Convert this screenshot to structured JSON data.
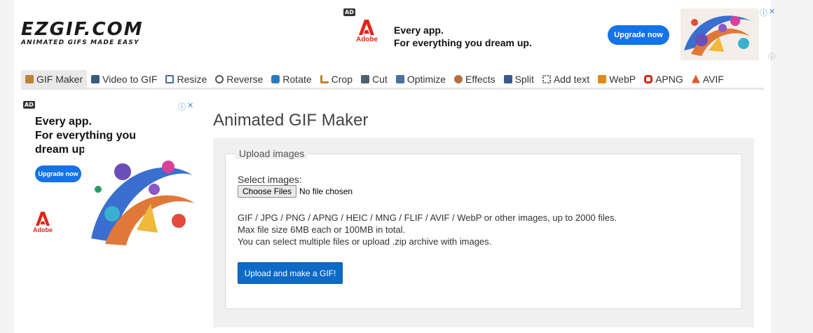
{
  "logo": {
    "main": "EZGIF.COM",
    "tagline": "ANIMATED GIFS MADE EASY"
  },
  "top_ad": {
    "badge": "AD",
    "brand": "Adobe",
    "headline_1": "Every app.",
    "headline_2": "For everything you dream up.",
    "cta": "Upgrade now",
    "info_icon": "info-icon",
    "close_icon": "close-icon"
  },
  "nav": {
    "items": [
      {
        "label": "GIF Maker",
        "icon": "gif-maker-icon",
        "color": "#c0803a",
        "active": true
      },
      {
        "label": "Video to GIF",
        "icon": "video-icon",
        "color": "#3a5a80"
      },
      {
        "label": "Resize",
        "icon": "resize-icon",
        "color": "#4a6a9a"
      },
      {
        "label": "Reverse",
        "icon": "reverse-icon",
        "color": "#555555"
      },
      {
        "label": "Rotate",
        "icon": "rotate-icon",
        "color": "#2a7ac0"
      },
      {
        "label": "Crop",
        "icon": "crop-icon",
        "color": "#c08030"
      },
      {
        "label": "Cut",
        "icon": "cut-icon",
        "color": "#506070"
      },
      {
        "label": "Optimize",
        "icon": "optimize-icon",
        "color": "#4a70a0"
      },
      {
        "label": "Effects",
        "icon": "effects-icon",
        "color": "#b07040"
      },
      {
        "label": "Split",
        "icon": "split-icon",
        "color": "#3a5a90"
      },
      {
        "label": "Add text",
        "icon": "add-text-icon",
        "color": "#606060"
      },
      {
        "label": "WebP",
        "icon": "webp-icon",
        "color": "#e08a1a"
      },
      {
        "label": "APNG",
        "icon": "apng-icon",
        "color": "#d02a1a"
      },
      {
        "label": "AVIF",
        "icon": "avif-icon",
        "color": "#e05a2a"
      }
    ]
  },
  "side_ad": {
    "badge": "AD",
    "headline_1": "Every app.",
    "headline_2": "For everything you",
    "headline_3": "dream up.",
    "cta": "Upgrade now",
    "brand": "Adobe"
  },
  "main": {
    "title": "Animated GIF Maker",
    "legend": "Upload images",
    "select_label": "Select images:",
    "choose_button": "Choose Files",
    "no_file": "No file chosen",
    "info_1": "GIF / JPG / PNG / APNG / HEIC / MNG / FLIF / AVIF / WebP or other images, up to 2000 files.",
    "info_2": "Max file size 6MB each or 100MB in total.",
    "info_3": "You can select multiple files or upload .zip archive with images.",
    "submit": "Upload and make a GIF!"
  },
  "colors": {
    "accent": "#0d6ac7",
    "adobe_red": "#e1251b",
    "adobe_blue": "#1473e6"
  }
}
